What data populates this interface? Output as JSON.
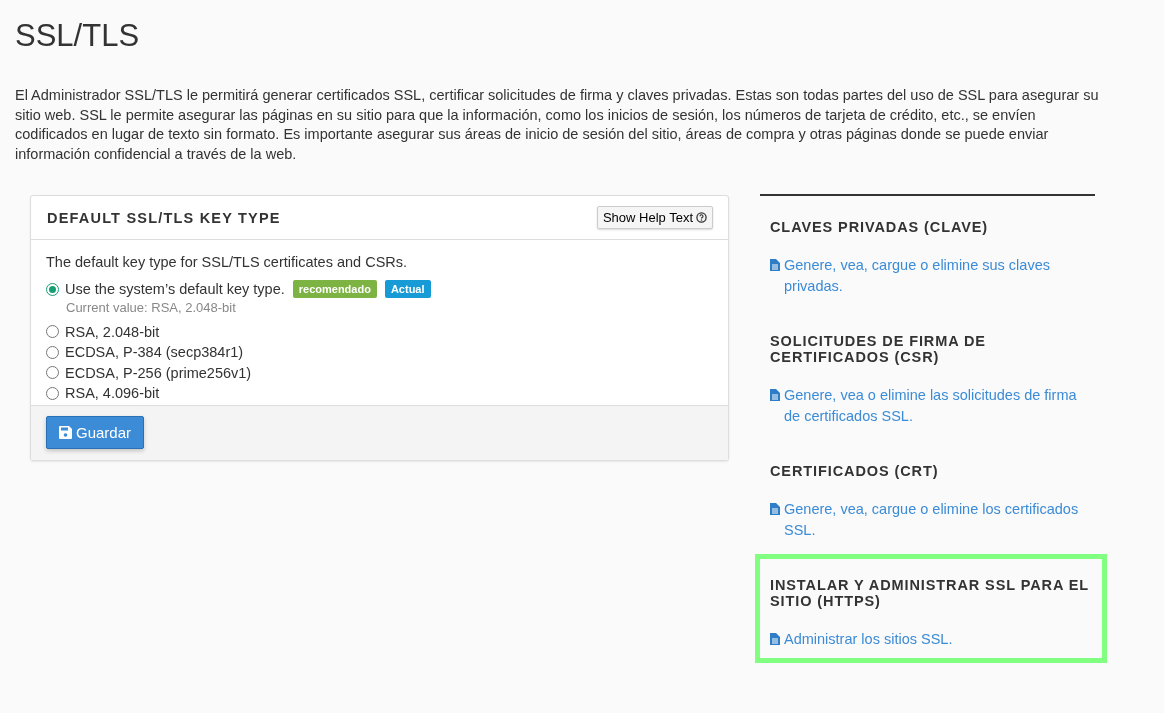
{
  "title": "SSL/TLS",
  "description": "El Administrador SSL/TLS le permitirá generar certificados SSL, certificar solicitudes de firma y claves privadas. Estas son todas partes del uso de SSL para asegurar su sitio web. SSL le permite asegurar las páginas en su sitio para que la información, como los inicios de sesión, los números de tarjeta de crédito, etc., se envíen codificados en lugar de texto sin formato. Es importante asegurar sus áreas de inicio de sesión del sitio, áreas de compra y otras páginas donde se puede enviar información confidencial a través de la web.",
  "panel": {
    "title": "DEFAULT SSL/TLS KEY TYPE",
    "help_button": "Show Help Text",
    "intro": "The default key type for SSL/TLS certificates and CSRs.",
    "options": [
      {
        "label": "Use the system’s default key type.",
        "selected": true,
        "badges": [
          {
            "text": "recomendado",
            "color": "#7cb342"
          },
          {
            "text": "Actual",
            "color": "#179bd7"
          }
        ],
        "note": "Current value: RSA, 2.048-bit"
      },
      {
        "label": "RSA, 2.048-bit",
        "selected": false
      },
      {
        "label": "ECDSA, P-384 (secp384r1)",
        "selected": false
      },
      {
        "label": "ECDSA, P-256 (prime256v1)",
        "selected": false
      },
      {
        "label": "RSA, 4.096-bit",
        "selected": false
      }
    ],
    "save_button": "Guardar"
  },
  "sections": [
    {
      "heading": "CLAVES PRIVADAS (CLAVE)",
      "link": "Genere, vea, cargue o elimine sus claves privadas.",
      "highlighted": false
    },
    {
      "heading": "SOLICITUDES DE FIRMA DE CERTIFICADOS (CSR)",
      "link": "Genere, vea o elimine las solicitudes de firma de certificados SSL.",
      "highlighted": false
    },
    {
      "heading": "CERTIFICADOS (CRT)",
      "link": "Genere, vea, cargue o elimine los certificados SSL.",
      "highlighted": false
    },
    {
      "heading": "INSTALAR Y ADMINISTRAR SSL PARA EL SITIO (HTTPS)",
      "link": "Administrar los sitios SSL.",
      "highlighted": true
    }
  ]
}
